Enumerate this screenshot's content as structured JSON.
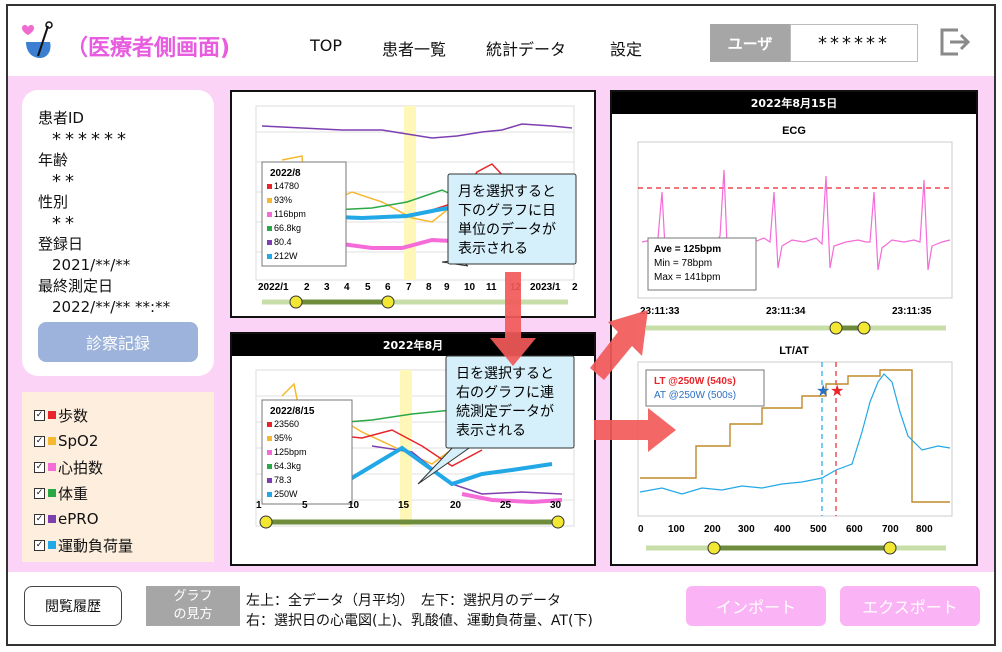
{
  "header": {
    "title": "（医療者側画面)",
    "nav": [
      "TOP",
      "患者一覧",
      "統計データ",
      "設定"
    ],
    "user_label": "ユーザ",
    "user_value": "******"
  },
  "patient": {
    "id_label": "患者ID",
    "id_value": "******",
    "age_label": "年齢",
    "age_value": "**",
    "sex_label": "性別",
    "sex_value": "**",
    "reg_label": "登録日",
    "reg_value": "2021/**/**",
    "last_label": "最終測定日",
    "last_value": "2022/**/** **:**",
    "diag_button": "診察記録"
  },
  "legend": [
    {
      "label": "歩数",
      "color": "#e8252a"
    },
    {
      "label": "SpO2",
      "color": "#f5b82e"
    },
    {
      "label": "心拍数",
      "color": "#f56bd8"
    },
    {
      "label": "体重",
      "color": "#2aa846"
    },
    {
      "label": "ePRO",
      "color": "#7d3fb0"
    },
    {
      "label": "運動負荷量",
      "color": "#22a8e6"
    }
  ],
  "colors": {
    "steps": "#e8252a",
    "spo2": "#f5b82e",
    "hr": "#f56bd8",
    "weight": "#2aa846",
    "epro": "#7d3fb0",
    "load": "#22a8e6",
    "accent": "#e85de0",
    "header_panel": "#000000"
  },
  "panel_monthly": {
    "xticks": [
      "2022/1",
      "2",
      "3",
      "4",
      "5",
      "6",
      "7",
      "8",
      "9",
      "10",
      "11",
      "12",
      "2023/1",
      "2"
    ],
    "tooltip": {
      "title": "2022/8",
      "rows": [
        "14780",
        "93%",
        "116bpm",
        "66.8kg",
        "80.4",
        "212W"
      ]
    },
    "callout": [
      "月を選択すると",
      "下のグラフに日",
      "単位のデータが",
      "表示される"
    ]
  },
  "panel_daily": {
    "title": "2022年8月",
    "xticks": [
      "1",
      "5",
      "10",
      "15",
      "20",
      "25",
      "30"
    ],
    "tooltip": {
      "title": "2022/8/15",
      "rows": [
        "23560",
        "95%",
        "125bpm",
        "64.3kg",
        "78.3",
        "250W"
      ]
    },
    "callout": [
      "日を選択すると",
      "右のグラフに連",
      "続測定データが",
      "表示される"
    ]
  },
  "panel_right": {
    "title": "2022年8月15日",
    "ecg_title": "ECG",
    "ecg_info": [
      "Ave  = 125bpm",
      "Min   =   78bpm",
      "Max = 141bpm"
    ],
    "ecg_xticks": [
      "23:11:33",
      "23:11:34",
      "23:11:35"
    ],
    "ltat_title": "LT/AT",
    "lt_label": "LT @250W (540s)",
    "at_label": "AT @250W (500s)",
    "ltat_xticks": [
      "0",
      "100",
      "200",
      "300",
      "400",
      "500",
      "600",
      "700",
      "800"
    ]
  },
  "footer": {
    "history_button": "閲覧履歴",
    "howto_line1": "グラフ",
    "howto_line2": "の見方",
    "desc_line1": "左上：全データ（月平均）　左下：選択月のデータ",
    "desc_line2": "右：選択日の心電図(上)、乳酸値、運動負荷量、AT(下)",
    "import_button": "インポート",
    "export_button": "エクスポート"
  }
}
